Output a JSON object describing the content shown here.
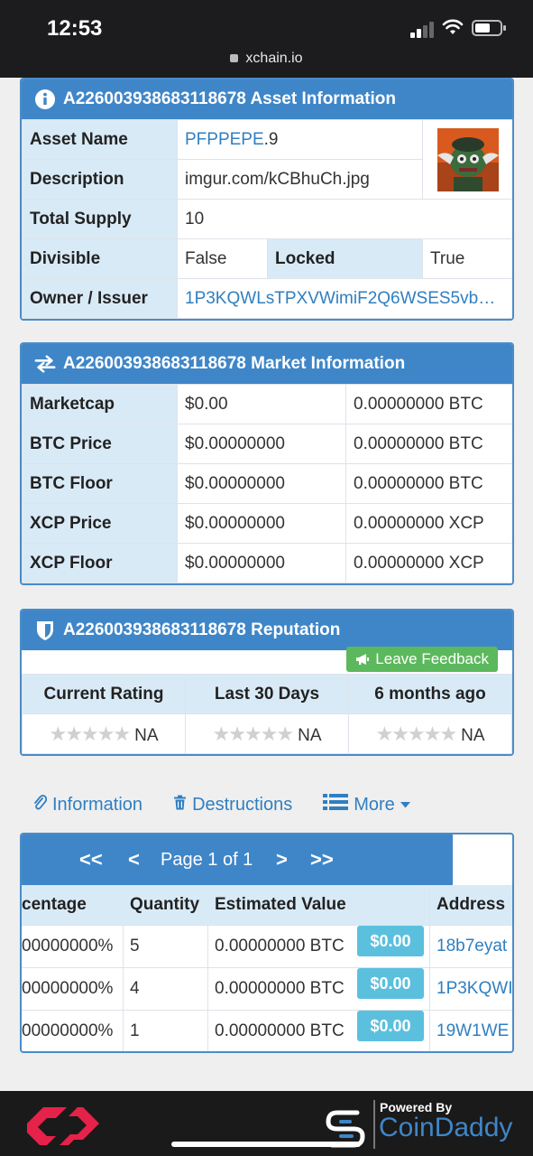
{
  "status": {
    "time": "12:53",
    "url": "xchain.io"
  },
  "asset_info": {
    "title": "A226003938683118678 Asset Information",
    "rows": {
      "asset_name_label": "Asset Name",
      "asset_name_value": "PFPPEPE",
      "asset_name_suffix": ".9",
      "description_label": "Description",
      "description_value": "imgur.com/kCBhuCh.jpg",
      "total_supply_label": "Total Supply",
      "total_supply_value": "10",
      "divisible_label": "Divisible",
      "divisible_value": "False",
      "locked_label": "Locked",
      "locked_value": "True",
      "owner_label": "Owner / Issuer",
      "owner_value": "1P3KQWLsTPXVWimiF2Q6WSES5vb…"
    }
  },
  "market_info": {
    "title": "A226003938683118678 Market Information",
    "rows": [
      {
        "label": "Marketcap",
        "usd": "$0.00",
        "native": "0.00000000 BTC"
      },
      {
        "label": "BTC Price",
        "usd": "$0.00000000",
        "native": "0.00000000 BTC"
      },
      {
        "label": "BTC Floor",
        "usd": "$0.00000000",
        "native": "0.00000000 BTC"
      },
      {
        "label": "XCP Price",
        "usd": "$0.00000000",
        "native": "0.00000000 XCP"
      },
      {
        "label": "XCP Floor",
        "usd": "$0.00000000",
        "native": "0.00000000 XCP"
      }
    ]
  },
  "reputation": {
    "title": "A226003938683118678 Reputation",
    "feedback_button": "Leave Feedback",
    "headers": [
      "Current Rating",
      "Last 30 Days",
      "6 months ago"
    ],
    "values": [
      "NA",
      "NA",
      "NA"
    ]
  },
  "tabs": {
    "information": "Information",
    "destructions": "Destructions",
    "more": "More"
  },
  "holders": {
    "pager": {
      "first": "<<",
      "prev": "<",
      "label": "Page 1 of 1",
      "next": ">",
      "last": ">>"
    },
    "headers": {
      "percentage": "centage",
      "quantity": "Quantity",
      "estimated": "Estimated Value",
      "address": "Address"
    },
    "rows": [
      {
        "percentage": "00000000%",
        "quantity": "5",
        "estimated": "0.00000000 BTC",
        "usd": "$0.00",
        "address": "18b7eyat"
      },
      {
        "percentage": "00000000%",
        "quantity": "4",
        "estimated": "0.00000000 BTC",
        "usd": "$0.00",
        "address": "1P3KQWI"
      },
      {
        "percentage": "00000000%",
        "quantity": "1",
        "estimated": "0.00000000 BTC",
        "usd": "$0.00",
        "address": "19W1WE"
      }
    ]
  },
  "footer": {
    "powered_by": "Powered By",
    "brand": "CoinDaddy"
  },
  "colors": {
    "primary": "#3f86c8",
    "label_bg": "#d9eaf7",
    "link": "#2f7fc1",
    "success": "#5cb85c",
    "info": "#5bc0de"
  }
}
